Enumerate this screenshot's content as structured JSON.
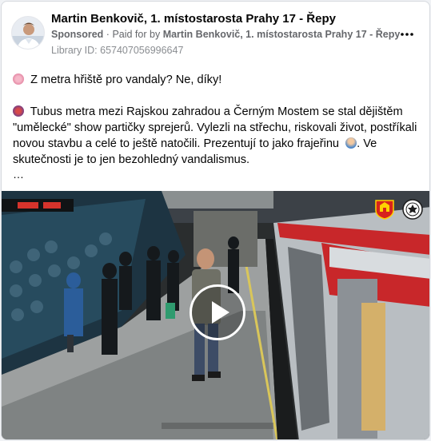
{
  "post": {
    "page_name": "Martin Benkovič, 1. místostarosta Prahy 17 - Řepy",
    "sponsored_label": "Sponsored",
    "separator": "·",
    "paid_for_prefix": "Paid for by",
    "paid_for_name": "Martin Benkovič, 1. místostarosta Prahy 17 - Řepy",
    "library_id": "Library ID: 657407056996647",
    "more_icon": "more-horizontal-icon",
    "paragraph_1": "Z metra hřiště pro vandaly? Ne, díky!",
    "paragraph_2": "Tubus metra mezi Rajskou zahradou a Černým Mostem se stal dějištěm \"umělecké\" show partičky sprejerů. Vylezli na střechu, riskovali život, postříkali novou stavbu a celé to ještě natočili. Prezentují to jako frajeřinu",
    "paragraph_2_tail": ". Ve skutečnosti je to jen bezohledný vandalismus.",
    "see_more": "…",
    "video": {
      "play_icon": "play-icon",
      "crest_left_icon": "prague-coat-of-arms-icon",
      "crest_right_icon": "police-badge-icon"
    }
  },
  "colors": {
    "text": "#050505",
    "secondary_text": "#65676b",
    "train_red": "#c8272a"
  }
}
